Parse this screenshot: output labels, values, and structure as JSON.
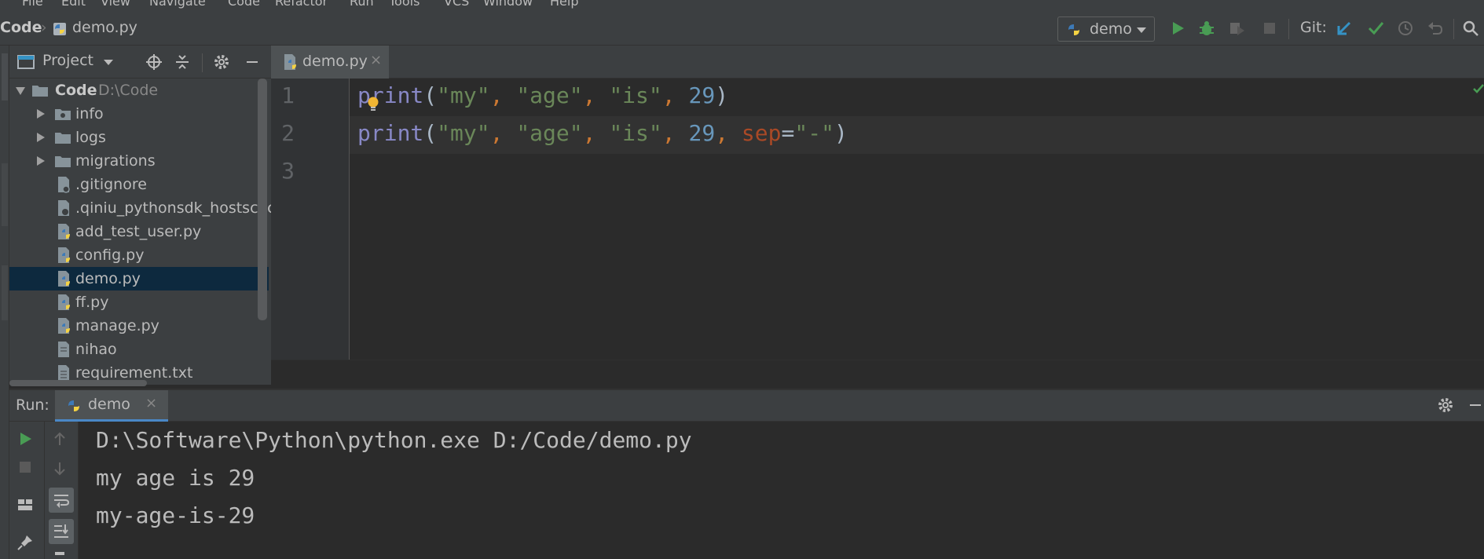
{
  "menu": [
    "File",
    "Edit",
    "View",
    "Navigate",
    "Code",
    "Refactor",
    "Run",
    "Tools",
    "VCS",
    "Window",
    "Help"
  ],
  "navbar": {
    "breadcrumb_root": "Code",
    "breadcrumb_file": "demo.py",
    "run_config": "demo",
    "git_label": "Git:"
  },
  "project_panel": {
    "title": "Project",
    "root": {
      "name": "Code",
      "path": "D:\\Code"
    },
    "items": [
      {
        "label": "info",
        "type": "folder"
      },
      {
        "label": "logs",
        "type": "folder"
      },
      {
        "label": "migrations",
        "type": "folder"
      },
      {
        "label": ".gitignore",
        "type": "file"
      },
      {
        "label": ".qiniu_pythonsdk_hostscache",
        "type": "file"
      },
      {
        "label": "add_test_user.py",
        "type": "python"
      },
      {
        "label": "config.py",
        "type": "python"
      },
      {
        "label": "demo.py",
        "type": "python",
        "selected": true
      },
      {
        "label": "ff.py",
        "type": "python"
      },
      {
        "label": "manage.py",
        "type": "python"
      },
      {
        "label": "nihao",
        "type": "file"
      },
      {
        "label": "requirement.txt",
        "type": "text"
      }
    ]
  },
  "editor": {
    "tab": "demo.py",
    "line_numbers": [
      "1",
      "2",
      "3"
    ],
    "line1": {
      "fn": "print",
      "open": "(",
      "s1": "\"my\"",
      "c1": ", ",
      "s2": "\"age\"",
      "c2": ", ",
      "s3": "\"is\"",
      "c3": ", ",
      "num": "29",
      "close": ")"
    },
    "line2": {
      "fn": "print",
      "open": "(",
      "s1": "\"my\"",
      "c1": ", ",
      "s2": "\"age\"",
      "c2": ", ",
      "s3": "\"is\"",
      "c3": ", ",
      "num": "29",
      "c4": ", ",
      "kw": "sep",
      "eq": "=",
      "s4": "\"-\"",
      "close": ")"
    }
  },
  "run_panel": {
    "label": "Run:",
    "tab": "demo",
    "console": [
      "D:\\Software\\Python\\python.exe D:/Code/demo.py",
      "my age is 29",
      "my-age-is-29"
    ]
  },
  "colors": {
    "function": "#8888c6",
    "string": "#6a8759",
    "number": "#6897bb",
    "keyword_arg": "#aa4926",
    "punct": "#a9b7c6",
    "selection": "#0d293e",
    "accent": "#4a88c7"
  },
  "icons": [
    "project-icon",
    "locate-icon",
    "collapse-icon",
    "gear-icon",
    "minimize-icon",
    "run-icon",
    "debug-icon",
    "coverage-icon",
    "stop-icon",
    "git-update-icon",
    "git-commit-icon",
    "history-icon",
    "rollback-icon",
    "search-icon",
    "python-icon",
    "folder-icon",
    "file-icon",
    "bulb-icon",
    "pin-icon",
    "wrap-icon",
    "scroll-end-icon",
    "layout-icon"
  ]
}
